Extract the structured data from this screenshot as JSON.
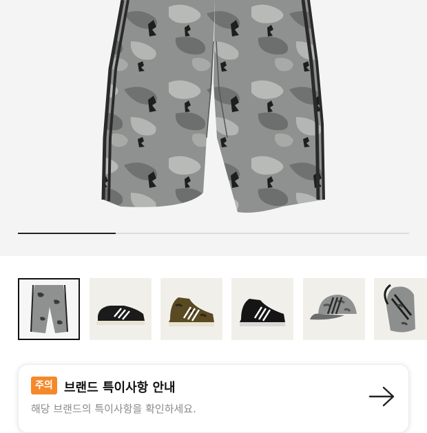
{
  "gallery": {
    "progress": 0.25,
    "thumbnails": [
      {
        "name": "camo-track-pants",
        "selected": true
      },
      {
        "name": "black-white-sneaker",
        "selected": false
      },
      {
        "name": "camo-high-top-sneaker",
        "selected": false
      },
      {
        "name": "black-high-top-sneaker",
        "selected": false
      },
      {
        "name": "camo-cap",
        "selected": false
      },
      {
        "name": "camo-sling-bag",
        "selected": false
      }
    ]
  },
  "notice": {
    "badge": "주의",
    "title": "브랜드 특이사항 안내",
    "subtitle": "해당 브랜드의 특이사항을 확인하세요.",
    "arrow_icon": "arrow-right-icon"
  }
}
